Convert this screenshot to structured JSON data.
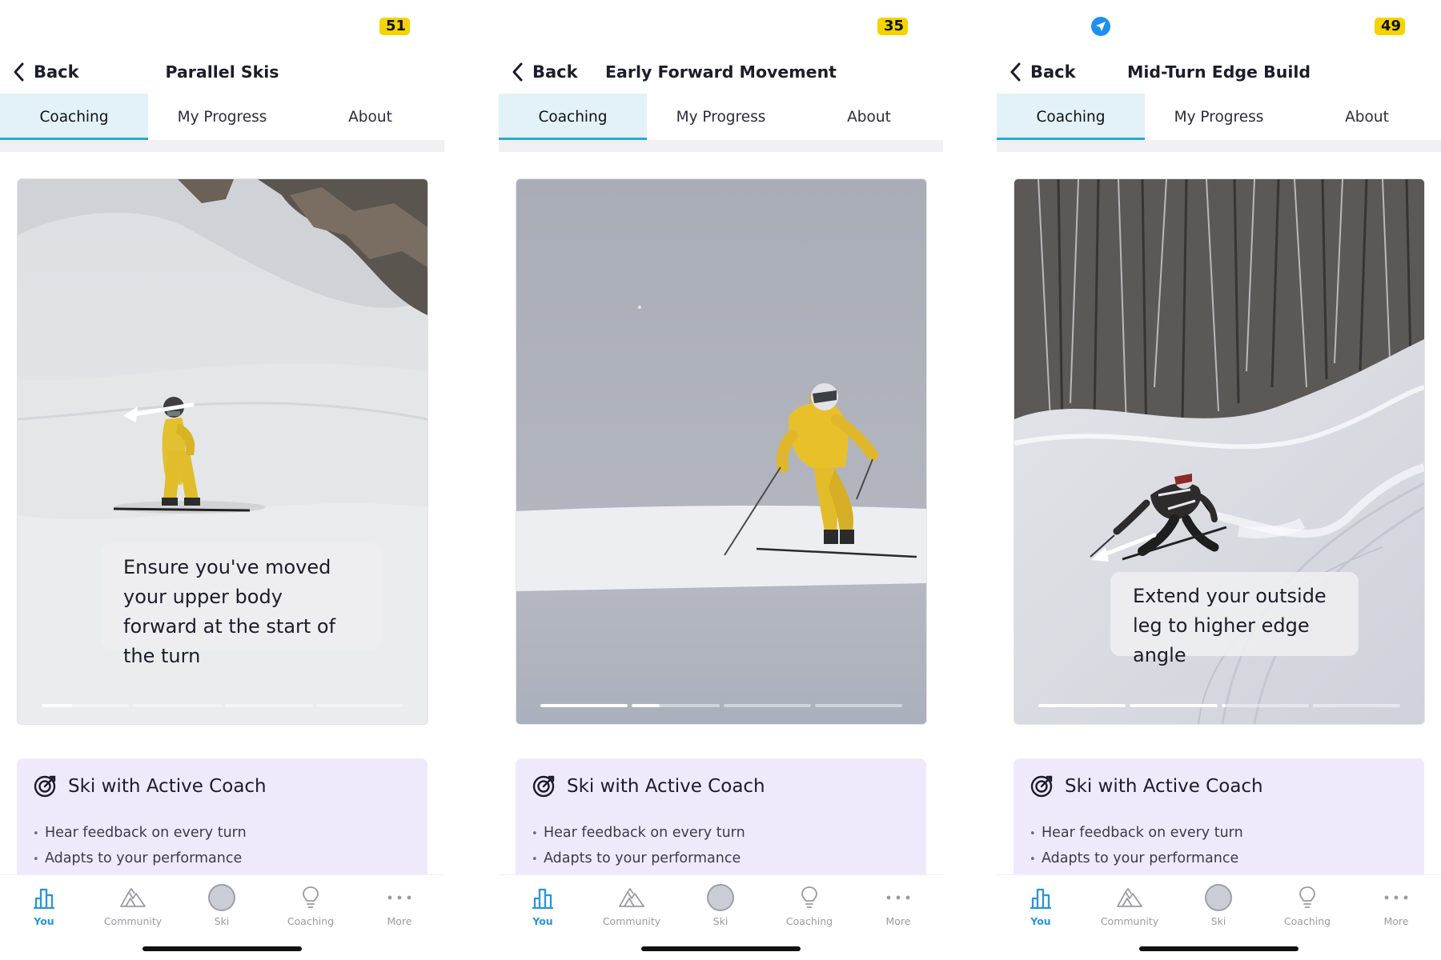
{
  "screens": [
    {
      "status": {
        "time_badge": "51",
        "location_icon": false
      },
      "nav": {
        "back_label": "Back",
        "title": "Parallel Skis"
      },
      "tabs": [
        {
          "label": "Coaching",
          "active": true
        },
        {
          "label": "My Progress",
          "active": false
        },
        {
          "label": "About",
          "active": false
        }
      ],
      "video": {
        "scene": "alpine-slope-skier-yellow",
        "caption": "Ensure you've moved your upper body forward at the start of the turn",
        "progress_segments": [
          0.35,
          0,
          0,
          0
        ]
      },
      "coach": {
        "icon": "target-icon",
        "title": "Ski with Active Coach",
        "bullets": [
          "Hear feedback on every turn",
          "Adapts to your performance"
        ]
      },
      "tabbar": [
        {
          "label": "You",
          "icon": "bar-chart-icon",
          "active": true
        },
        {
          "label": "Community",
          "icon": "mountains-icon",
          "active": false
        },
        {
          "label": "Ski",
          "icon": "record-circle-icon",
          "active": false
        },
        {
          "label": "Coaching",
          "icon": "lightbulb-icon",
          "active": false
        },
        {
          "label": "More",
          "icon": "ellipsis-icon",
          "active": false
        }
      ]
    },
    {
      "status": {
        "time_badge": "35",
        "location_icon": false
      },
      "nav": {
        "back_label": "Back",
        "title": "Early Forward Movement"
      },
      "tabs": [
        {
          "label": "Coaching",
          "active": true
        },
        {
          "label": "My Progress",
          "active": false
        },
        {
          "label": "About",
          "active": false
        }
      ],
      "video": {
        "scene": "flat-light-skier-yellow",
        "caption": "",
        "progress_segments": [
          1,
          0.32,
          0,
          0
        ]
      },
      "coach": {
        "icon": "target-icon",
        "title": "Ski with Active Coach",
        "bullets": [
          "Hear feedback on every turn",
          "Adapts to your performance"
        ]
      },
      "tabbar": [
        {
          "label": "You",
          "icon": "bar-chart-icon",
          "active": true
        },
        {
          "label": "Community",
          "icon": "mountains-icon",
          "active": false
        },
        {
          "label": "Ski",
          "icon": "record-circle-icon",
          "active": false
        },
        {
          "label": "Coaching",
          "icon": "lightbulb-icon",
          "active": false
        },
        {
          "label": "More",
          "icon": "ellipsis-icon",
          "active": false
        }
      ]
    },
    {
      "status": {
        "time_badge": "49",
        "location_icon": true
      },
      "nav": {
        "back_label": "Back",
        "title": "Mid-Turn Edge Build"
      },
      "tabs": [
        {
          "label": "Coaching",
          "active": true
        },
        {
          "label": "My Progress",
          "active": false
        },
        {
          "label": "About",
          "active": false
        }
      ],
      "video": {
        "scene": "forest-piste-carving-skier",
        "caption": "Extend your outside leg to higher edge angle",
        "progress_segments": [
          1,
          1,
          0.05,
          0
        ]
      },
      "coach": {
        "icon": "target-icon",
        "title": "Ski with Active Coach",
        "bullets": [
          "Hear feedback on every turn",
          "Adapts to your performance"
        ]
      },
      "tabbar": [
        {
          "label": "You",
          "icon": "bar-chart-icon",
          "active": true
        },
        {
          "label": "Community",
          "icon": "mountains-icon",
          "active": false
        },
        {
          "label": "Ski",
          "icon": "record-circle-icon",
          "active": false
        },
        {
          "label": "Coaching",
          "icon": "lightbulb-icon",
          "active": false
        },
        {
          "label": "More",
          "icon": "ellipsis-icon",
          "active": false
        }
      ]
    }
  ],
  "colors": {
    "accent": "#2aa8d8",
    "tab_active_bg": "#e3f2f8",
    "coach_card_bg": "#efeafb",
    "badge": "#f5d300",
    "tabbar_active": "#2a95d6",
    "skier_jacket": "#e8c02a"
  }
}
